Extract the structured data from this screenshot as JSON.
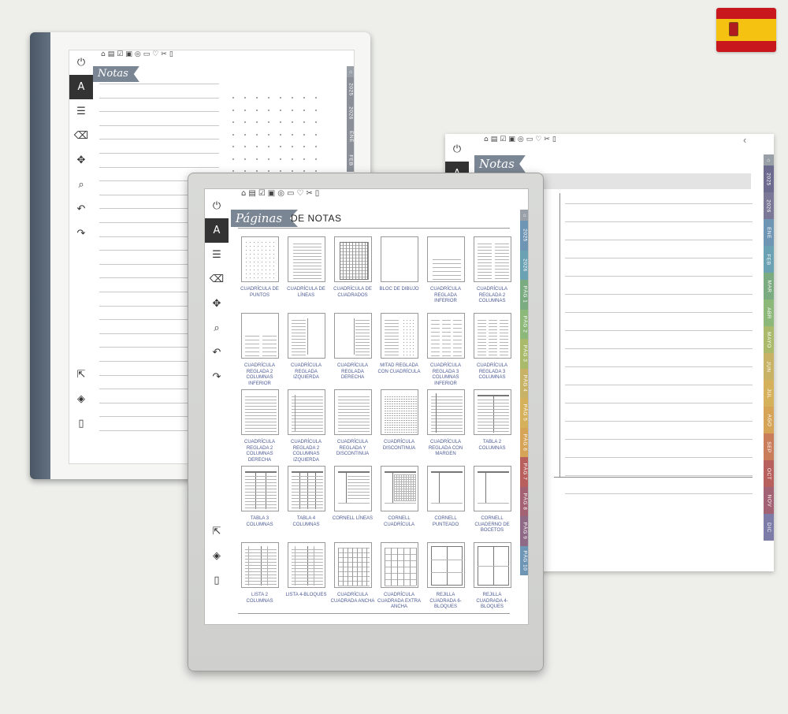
{
  "flag": {
    "country": "España",
    "colors": {
      "red": "#c8181e",
      "yellow": "#f6c211"
    }
  },
  "toolbar_icons": [
    "home-icon",
    "clipboard-icon",
    "checkbox-icon",
    "briefcase-icon",
    "target-icon",
    "wallet-icon",
    "heart-icon",
    "scissors-icon",
    "page-icon"
  ],
  "sidebar_icons": [
    "power-icon",
    "pen-icon",
    "menu-icon",
    "eraser-icon",
    "move-icon",
    "zoom-icon",
    "undo-icon",
    "redo-icon",
    "share-icon",
    "layers-icon",
    "notebook-icon"
  ],
  "back_left": {
    "banner": "Notas"
  },
  "back_right": {
    "banner": "Notas",
    "back_chevron": "‹"
  },
  "front": {
    "banner": "Páginas",
    "heading": "DE NOTAS"
  },
  "tabs_short": [
    {
      "label": "2025",
      "color": "#8a8f98"
    },
    {
      "label": "2026",
      "color": "#8a8f98"
    },
    {
      "label": "ENE",
      "color": "#8a8f98"
    },
    {
      "label": "FEB",
      "color": "#8a8f98"
    }
  ],
  "tabs_right": [
    {
      "label": "2025",
      "color": "#6c6a8e"
    },
    {
      "label": "2026",
      "color": "#7a7896"
    },
    {
      "label": "ENE",
      "color": "#6f95b5"
    },
    {
      "label": "FEB",
      "color": "#6aa1b3"
    },
    {
      "label": "MAR",
      "color": "#7bab80"
    },
    {
      "label": "ABR",
      "color": "#8cb87a"
    },
    {
      "label": "MAYO",
      "color": "#a9bb6a"
    },
    {
      "label": "JUN",
      "color": "#c7b265"
    },
    {
      "label": "JUL",
      "color": "#d6b15b"
    },
    {
      "label": "AGO",
      "color": "#d6a457"
    },
    {
      "label": "SEP",
      "color": "#c97d5a"
    },
    {
      "label": "OCT",
      "color": "#b8605e"
    },
    {
      "label": "NOV",
      "color": "#a36273"
    },
    {
      "label": "DIC",
      "color": "#7d7ca8"
    }
  ],
  "tabs_front": [
    {
      "label": "2025",
      "color": "#6f95b5"
    },
    {
      "label": "2026",
      "color": "#6aa1b3"
    },
    {
      "label": "PÁG 1",
      "color": "#7bab80"
    },
    {
      "label": "PÁG 2",
      "color": "#8cb87a"
    },
    {
      "label": "PÁG 3",
      "color": "#a9bb6a"
    },
    {
      "label": "PÁG 4",
      "color": "#c7b265"
    },
    {
      "label": "PÁG 5",
      "color": "#d6b15b"
    },
    {
      "label": "PÁG 6",
      "color": "#d6a457"
    },
    {
      "label": "PÁG 7",
      "color": "#b8605e"
    },
    {
      "label": "PÁG 8",
      "color": "#a36273"
    },
    {
      "label": "PÁG 9",
      "color": "#8f6a86"
    },
    {
      "label": "PÁG 10",
      "color": "#6f95b5"
    }
  ],
  "templates": [
    {
      "label": "CUADRÍCULA DE PUNTOS",
      "kind": "dots"
    },
    {
      "label": "CUADRÍCULA DE LÍNEAS",
      "kind": "lines"
    },
    {
      "label": "CUADRÍCULA DE CUADRADOS",
      "kind": "squares"
    },
    {
      "label": "BLOC DE DIBUJO",
      "kind": "blank"
    },
    {
      "label": "CUADRÍCULA REGLADA INFERIOR",
      "kind": "lines-bottom"
    },
    {
      "label": "CUADRÍCULA REGLADA 2 COLUMNAS",
      "kind": "two-col"
    },
    {
      "label": "CUADRÍCULA REGLADA 2 COLUMNAS INFERIOR",
      "kind": "two-col-bottom"
    },
    {
      "label": "CUADRÍCULA REGLADA IZQUIERDA",
      "kind": "left"
    },
    {
      "label": "CUADRÍCULA REGLADA DERECHA",
      "kind": "right"
    },
    {
      "label": "MITAD REGLADA CON CUADRÍCULA",
      "kind": "half"
    },
    {
      "label": "CUADRÍCULA REGLADA 3 COLUMNAS INFERIOR",
      "kind": "three-col-bottom"
    },
    {
      "label": "CUADRÍCULA REGLADA 3 COLUMNAS",
      "kind": "three-col"
    },
    {
      "label": "CUADRÍCULA REGLADA 2 COLUMNAS DERECHA",
      "kind": "two-col-right"
    },
    {
      "label": "CUADRÍCULA REGLADA 2 COLUMNAS IZQUIERDA",
      "kind": "two-col-left"
    },
    {
      "label": "CUADRÍCULA REGLADA Y DISCONTINUA",
      "kind": "dashed"
    },
    {
      "label": "CUADRÍCULA DISCONTINUA",
      "kind": "dashed-all"
    },
    {
      "label": "CUADRÍCULA REGLADA CON MARGEN",
      "kind": "margin"
    },
    {
      "label": "TABLA 2 COLUMNAS",
      "kind": "table2"
    },
    {
      "label": "TABLA 3 COLUMNAS",
      "kind": "table3"
    },
    {
      "label": "TABLA 4 COLUMNAS",
      "kind": "table4"
    },
    {
      "label": "CORNELL LÍNEAS",
      "kind": "cornell"
    },
    {
      "label": "CORNELL CUADRÍCULA",
      "kind": "cornell-grid"
    },
    {
      "label": "CORNELL PUNTEADO",
      "kind": "cornell-dot"
    },
    {
      "label": "CORNELL CUADERNO DE BOCETOS",
      "kind": "cornell-blank"
    },
    {
      "label": "LISTA 2 COLUMNAS",
      "kind": "list2"
    },
    {
      "label": "LISTA 4-BLOQUES",
      "kind": "list4"
    },
    {
      "label": "CUADRÍCULA CUADRADA ANCHA",
      "kind": "grid-wide"
    },
    {
      "label": "CUADRÍCULA CUADRADA EXTRA ANCHA",
      "kind": "grid-xwide"
    },
    {
      "label": "REJILLA CUADRADA 6-BLOQUES",
      "kind": "grid6"
    },
    {
      "label": "REJILLA CUADRADA 4-BLOQUES",
      "kind": "grid4"
    }
  ]
}
